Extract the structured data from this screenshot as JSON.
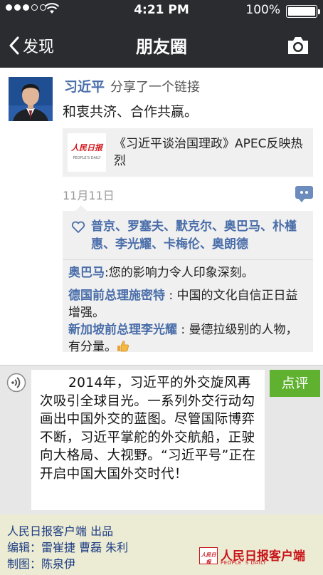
{
  "status_bar": {
    "time": "4:21 PM",
    "battery": "100%",
    "signal_dots_filled": 3,
    "signal_dots_total": 5
  },
  "nav": {
    "back_label": "发现",
    "title": "朋友圈",
    "camera_icon": "camera-icon"
  },
  "post": {
    "author": "习近平",
    "action": "分享了一个链接",
    "text": "和衷共济、合作共赢。",
    "link": {
      "thumb_logo": "人民日报",
      "thumb_sub": "PEOPLE'S DAILY",
      "title": "《习近平谈治国理政》APEC反映热烈"
    },
    "date": "11月11日"
  },
  "likes": "普京、罗塞夫、默克尔、奥巴马、朴槿惠、李光耀、卡梅伦、奥朗德",
  "comments": [
    {
      "who": "奥巴马",
      "sep": ":",
      "text": "您的影响力令人印象深刻。"
    },
    {
      "who": "德国前总理施密特",
      "sep": " : ",
      "text": "中国的文化自信正日益增强。"
    },
    {
      "who": "新加坡前总理李光耀",
      "sep": " : ",
      "text": "曼德拉级别的人物，有分量。"
    }
  ],
  "message": {
    "text": "2014年，习近平的外交旋风再次吸引全球目光。一系列外交行动勾画出中国外交的蓝图。尽管国际博弈不断，习近平掌舵的外交航船，正驶向大格局、大视野。“习近平号”正在开启中国大国外交时代！",
    "review_button": "点评"
  },
  "credits": {
    "line1": "人民日报客户端 出品",
    "line2": "编辑：雷崔捷 曹磊 朱利",
    "line3": "制图：陈泉伊",
    "brand_name": "人民日报客户端",
    "brand_sub": "PEOPLE' S DAILY",
    "brand_badge": "人民日报"
  },
  "colors": {
    "nav_bg": "#2a2c30",
    "link_blue": "#4a6ea9",
    "review_green": "#5fb12f",
    "brand_red": "#c9141a"
  }
}
